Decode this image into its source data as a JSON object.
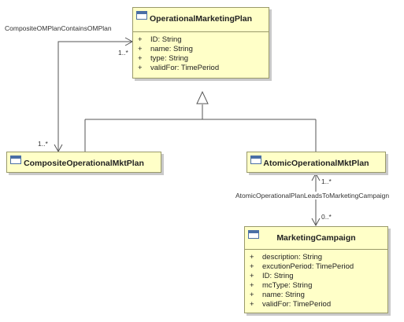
{
  "classes": {
    "operational_marketing_plan": {
      "name": "OperationalMarketingPlan",
      "attributes": [
        {
          "vis": "+",
          "text": "ID: String"
        },
        {
          "vis": "+",
          "text": "name: String"
        },
        {
          "vis": "+",
          "text": "type: String"
        },
        {
          "vis": "+",
          "text": "validFor: TimePeriod"
        }
      ]
    },
    "composite_operational_mkt_plan": {
      "name": "CompositeOperationalMktPlan"
    },
    "atomic_operational_mkt_plan": {
      "name": "AtomicOperationalMktPlan"
    },
    "marketing_campaign": {
      "name": "MarketingCampaign",
      "attributes": [
        {
          "vis": "+",
          "text": "description: String"
        },
        {
          "vis": "+",
          "text": "excutionPeriod: TimePeriod"
        },
        {
          "vis": "+",
          "text": "ID: String"
        },
        {
          "vis": "+",
          "text": "mcType: String"
        },
        {
          "vis": "+",
          "text": "name: String"
        },
        {
          "vis": "+",
          "text": "validFor: TimePeriod"
        }
      ]
    }
  },
  "associations": {
    "composite_contains": {
      "name": "CompositeOMPlanContainsOMPlan",
      "mult_source": "1..*",
      "mult_target": "1..*"
    },
    "atomic_leads_to": {
      "name": "AtomicOperationalPlanLeadsToMarketingCampaign",
      "mult_source": "1..*",
      "mult_target": "0..*"
    }
  }
}
